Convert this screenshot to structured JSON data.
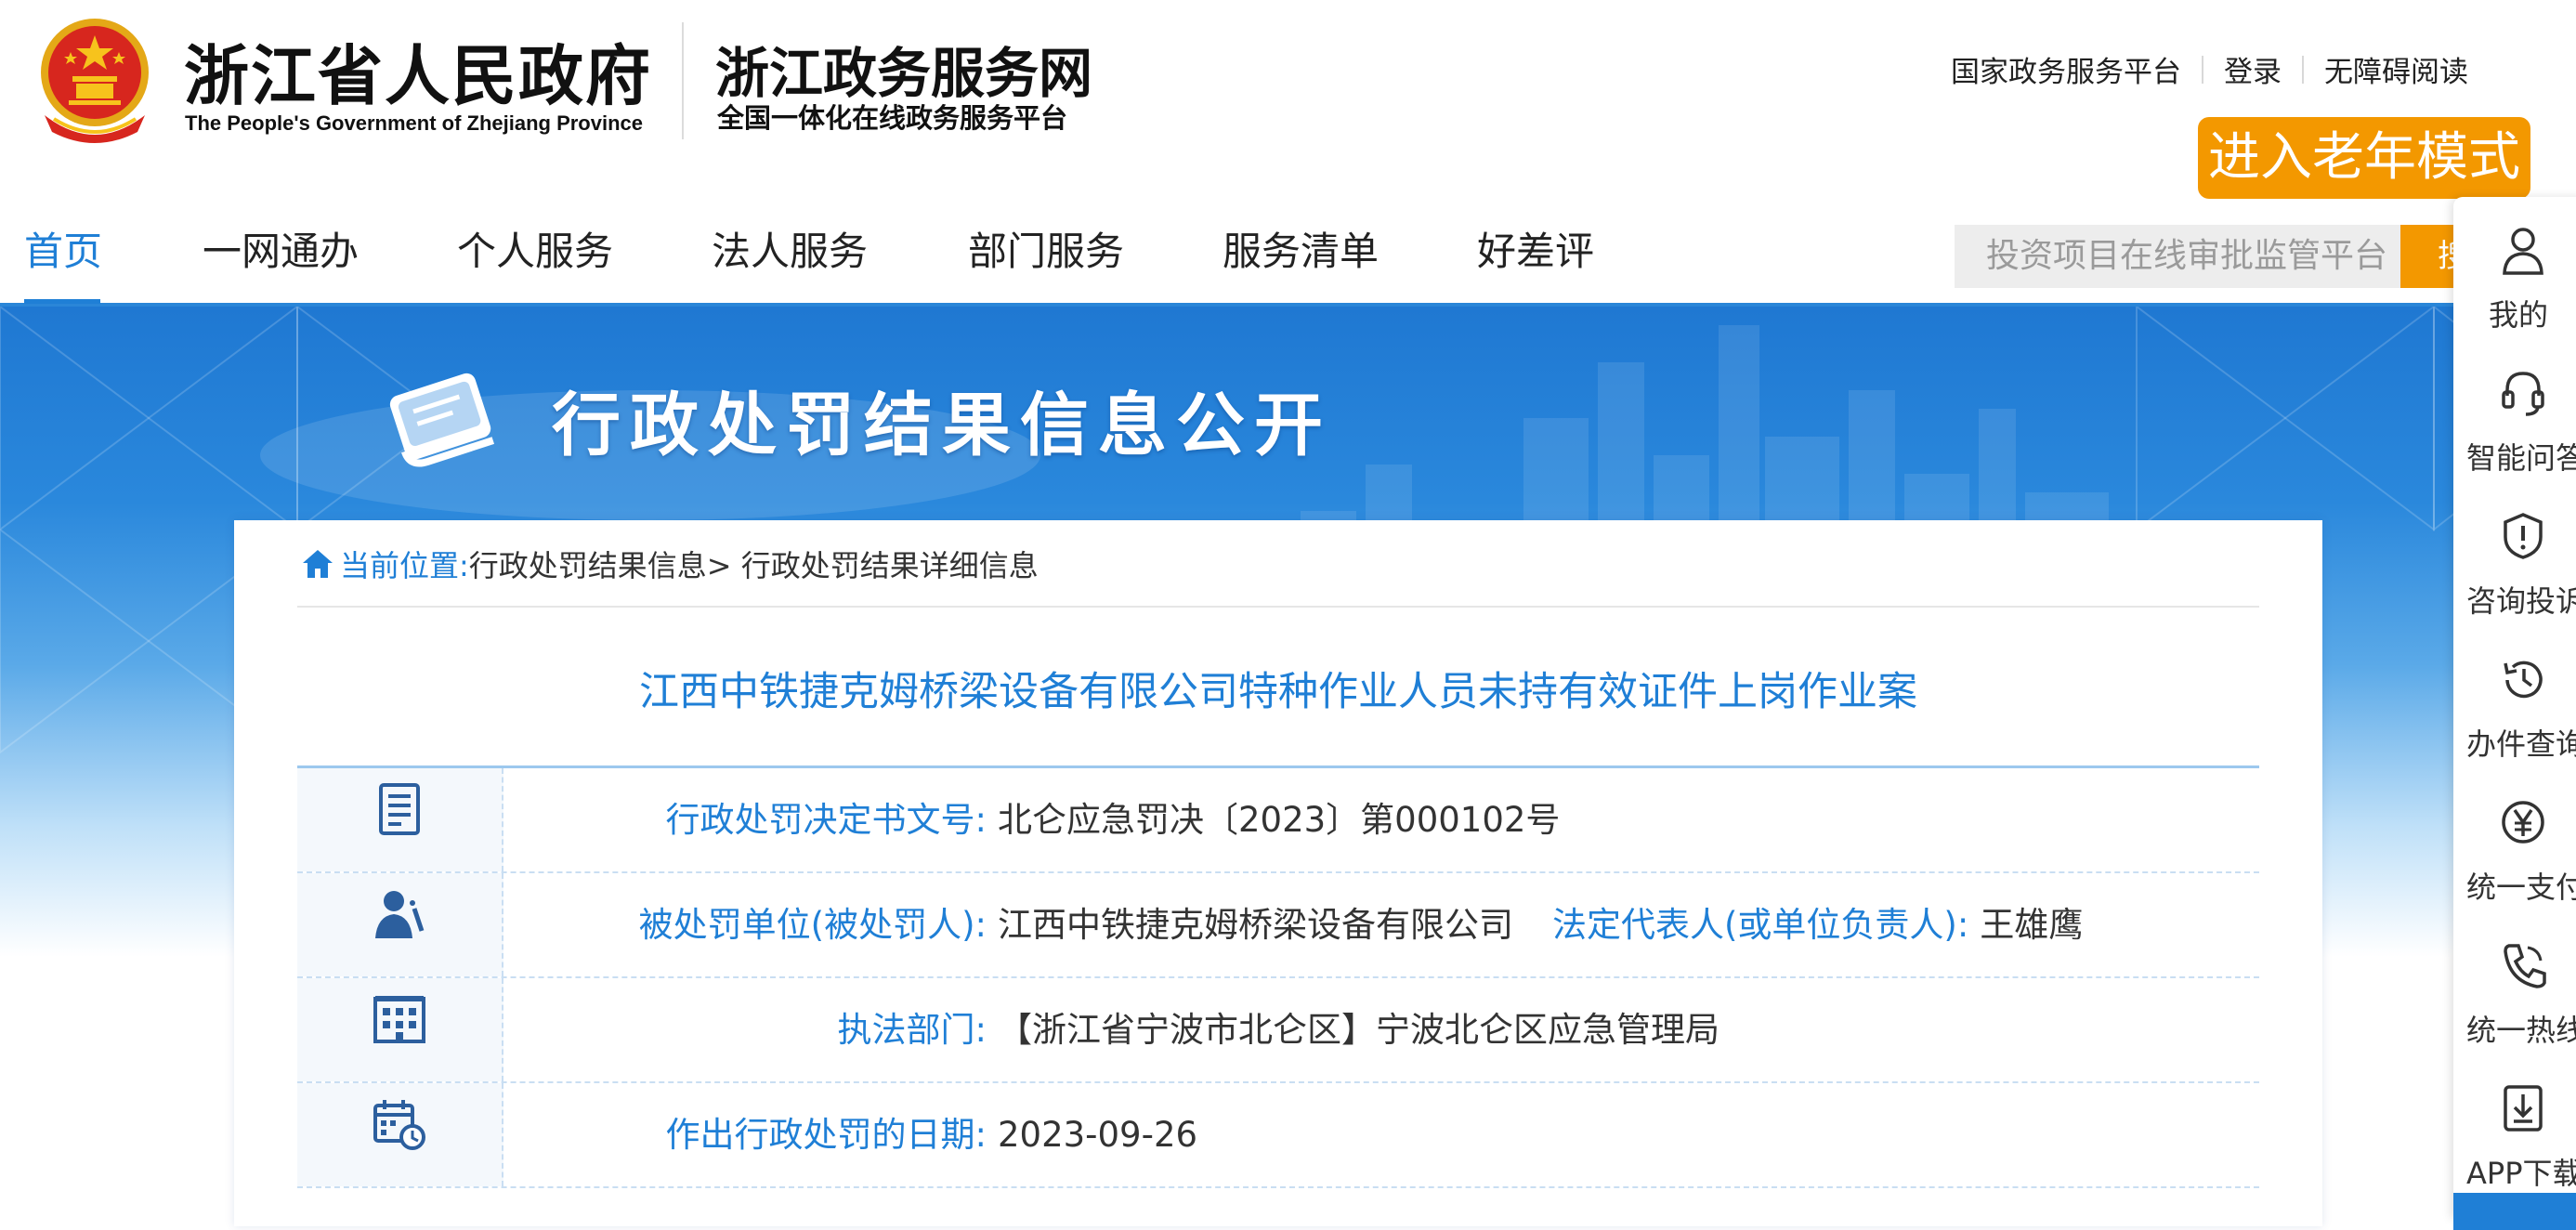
{
  "header": {
    "gov_title": "浙江省人民政府",
    "gov_en": "The People's Government of Zhejiang Province",
    "site_title": "浙江政务服务网",
    "site_subtitle": "全国一体化在线政务服务平台",
    "top_links": [
      "国家政务服务平台",
      "登录",
      "无障碍阅读"
    ],
    "elder_mode": "进入老年模式"
  },
  "nav": {
    "items": [
      "首页",
      "一网通办",
      "个人服务",
      "法人服务",
      "部门服务",
      "服务清单",
      "好差评"
    ],
    "active_index": 0,
    "search_placeholder": "投资项目在线审批监管平台",
    "search_button": "搜"
  },
  "banner": {
    "title": "行政处罚结果信息公开"
  },
  "breadcrumb": {
    "label": "当前位置:",
    "path": "行政处罚结果信息> 行政处罚结果详细信息"
  },
  "case": {
    "title": "江西中铁捷克姆桥梁设备有限公司特种作业人员未持有效证件上岗作业案",
    "rows": [
      {
        "icon": "document-icon",
        "label": "行政处罚决定书文号:",
        "value": "北仑应急罚决〔2023〕第000102号"
      },
      {
        "icon": "person-icon",
        "label": "被处罚单位(被处罚人):",
        "value": "江西中铁捷克姆桥梁设备有限公司",
        "label2": "法定代表人(或单位负责人):",
        "value2": "王雄鹰"
      },
      {
        "icon": "building-icon",
        "label": "执法部门:",
        "value": "【浙江省宁波市北仑区】宁波北仑区应急管理局"
      },
      {
        "icon": "calendar-icon",
        "label": "作出行政处罚的日期:",
        "value": "2023-09-26"
      }
    ]
  },
  "sidebar": {
    "items": [
      {
        "icon": "user-icon",
        "label": "我的"
      },
      {
        "icon": "headset-icon",
        "label": "智能问答"
      },
      {
        "icon": "shield-alert-icon",
        "label": "咨询投诉"
      },
      {
        "icon": "history-icon",
        "label": "办件查询"
      },
      {
        "icon": "yuan-icon",
        "label": "统一支付"
      },
      {
        "icon": "phone-icon",
        "label": "统一热线"
      },
      {
        "icon": "download-icon",
        "label": "APP下载"
      }
    ]
  },
  "colors": {
    "accent_blue": "#1f7fd6",
    "accent_orange": "#f39800"
  }
}
